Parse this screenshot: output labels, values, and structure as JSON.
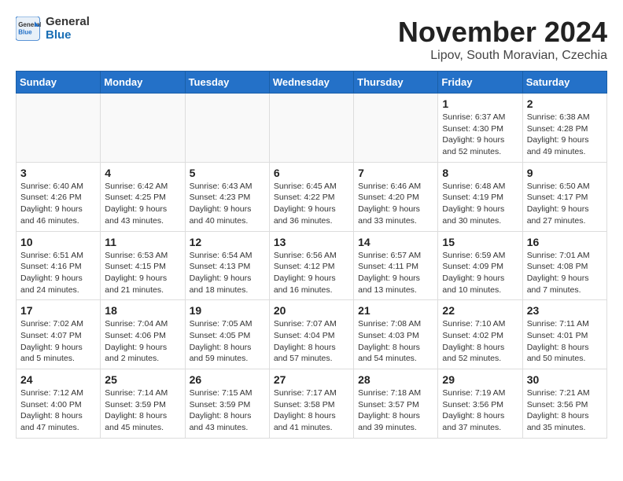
{
  "app": {
    "logo_general": "General",
    "logo_blue": "Blue",
    "title": "November 2024",
    "subtitle": "Lipov, South Moravian, Czechia"
  },
  "calendar": {
    "headers": [
      "Sunday",
      "Monday",
      "Tuesday",
      "Wednesday",
      "Thursday",
      "Friday",
      "Saturday"
    ],
    "weeks": [
      [
        {
          "day": "",
          "info": ""
        },
        {
          "day": "",
          "info": ""
        },
        {
          "day": "",
          "info": ""
        },
        {
          "day": "",
          "info": ""
        },
        {
          "day": "",
          "info": ""
        },
        {
          "day": "1",
          "info": "Sunrise: 6:37 AM\nSunset: 4:30 PM\nDaylight: 9 hours and 52 minutes."
        },
        {
          "day": "2",
          "info": "Sunrise: 6:38 AM\nSunset: 4:28 PM\nDaylight: 9 hours and 49 minutes."
        }
      ],
      [
        {
          "day": "3",
          "info": "Sunrise: 6:40 AM\nSunset: 4:26 PM\nDaylight: 9 hours and 46 minutes."
        },
        {
          "day": "4",
          "info": "Sunrise: 6:42 AM\nSunset: 4:25 PM\nDaylight: 9 hours and 43 minutes."
        },
        {
          "day": "5",
          "info": "Sunrise: 6:43 AM\nSunset: 4:23 PM\nDaylight: 9 hours and 40 minutes."
        },
        {
          "day": "6",
          "info": "Sunrise: 6:45 AM\nSunset: 4:22 PM\nDaylight: 9 hours and 36 minutes."
        },
        {
          "day": "7",
          "info": "Sunrise: 6:46 AM\nSunset: 4:20 PM\nDaylight: 9 hours and 33 minutes."
        },
        {
          "day": "8",
          "info": "Sunrise: 6:48 AM\nSunset: 4:19 PM\nDaylight: 9 hours and 30 minutes."
        },
        {
          "day": "9",
          "info": "Sunrise: 6:50 AM\nSunset: 4:17 PM\nDaylight: 9 hours and 27 minutes."
        }
      ],
      [
        {
          "day": "10",
          "info": "Sunrise: 6:51 AM\nSunset: 4:16 PM\nDaylight: 9 hours and 24 minutes."
        },
        {
          "day": "11",
          "info": "Sunrise: 6:53 AM\nSunset: 4:15 PM\nDaylight: 9 hours and 21 minutes."
        },
        {
          "day": "12",
          "info": "Sunrise: 6:54 AM\nSunset: 4:13 PM\nDaylight: 9 hours and 18 minutes."
        },
        {
          "day": "13",
          "info": "Sunrise: 6:56 AM\nSunset: 4:12 PM\nDaylight: 9 hours and 16 minutes."
        },
        {
          "day": "14",
          "info": "Sunrise: 6:57 AM\nSunset: 4:11 PM\nDaylight: 9 hours and 13 minutes."
        },
        {
          "day": "15",
          "info": "Sunrise: 6:59 AM\nSunset: 4:09 PM\nDaylight: 9 hours and 10 minutes."
        },
        {
          "day": "16",
          "info": "Sunrise: 7:01 AM\nSunset: 4:08 PM\nDaylight: 9 hours and 7 minutes."
        }
      ],
      [
        {
          "day": "17",
          "info": "Sunrise: 7:02 AM\nSunset: 4:07 PM\nDaylight: 9 hours and 5 minutes."
        },
        {
          "day": "18",
          "info": "Sunrise: 7:04 AM\nSunset: 4:06 PM\nDaylight: 9 hours and 2 minutes."
        },
        {
          "day": "19",
          "info": "Sunrise: 7:05 AM\nSunset: 4:05 PM\nDaylight: 8 hours and 59 minutes."
        },
        {
          "day": "20",
          "info": "Sunrise: 7:07 AM\nSunset: 4:04 PM\nDaylight: 8 hours and 57 minutes."
        },
        {
          "day": "21",
          "info": "Sunrise: 7:08 AM\nSunset: 4:03 PM\nDaylight: 8 hours and 54 minutes."
        },
        {
          "day": "22",
          "info": "Sunrise: 7:10 AM\nSunset: 4:02 PM\nDaylight: 8 hours and 52 minutes."
        },
        {
          "day": "23",
          "info": "Sunrise: 7:11 AM\nSunset: 4:01 PM\nDaylight: 8 hours and 50 minutes."
        }
      ],
      [
        {
          "day": "24",
          "info": "Sunrise: 7:12 AM\nSunset: 4:00 PM\nDaylight: 8 hours and 47 minutes."
        },
        {
          "day": "25",
          "info": "Sunrise: 7:14 AM\nSunset: 3:59 PM\nDaylight: 8 hours and 45 minutes."
        },
        {
          "day": "26",
          "info": "Sunrise: 7:15 AM\nSunset: 3:59 PM\nDaylight: 8 hours and 43 minutes."
        },
        {
          "day": "27",
          "info": "Sunrise: 7:17 AM\nSunset: 3:58 PM\nDaylight: 8 hours and 41 minutes."
        },
        {
          "day": "28",
          "info": "Sunrise: 7:18 AM\nSunset: 3:57 PM\nDaylight: 8 hours and 39 minutes."
        },
        {
          "day": "29",
          "info": "Sunrise: 7:19 AM\nSunset: 3:56 PM\nDaylight: 8 hours and 37 minutes."
        },
        {
          "day": "30",
          "info": "Sunrise: 7:21 AM\nSunset: 3:56 PM\nDaylight: 8 hours and 35 minutes."
        }
      ]
    ]
  }
}
